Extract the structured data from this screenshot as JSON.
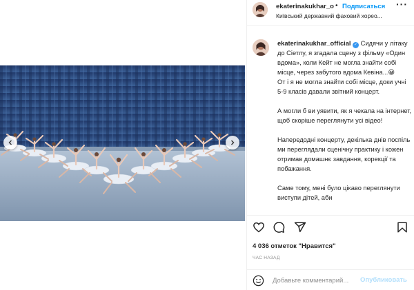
{
  "header": {
    "username": "ekaterinakukhar_o",
    "separator": "•",
    "follow_label": "Подписаться",
    "more_icon": "more-icon",
    "location": "Київський державний фаховий хорео..."
  },
  "caption": {
    "username": "ekaterinakukhar_official",
    "verified_icon": "verified-badge-icon",
    "paragraphs": [
      "Сидячи у літаку до Сіетлу, я згадала сцену з фільму «Один вдома», коли Кейт не могла знайти собі місце, через забутого вдома Кевіна...😀",
      "От і я не могла знайти собі місце, доки учні 5-9 класів давали звітний концерт.",
      "А могли б ви уявити, як я чекала на інтернет, щоб скоріше переглянути усі відео!",
      "Напередодні концерту, декілька днів поспіль ми переглядали сценічну практику і кожен отримав домашнє завдання, корекції та побажання.",
      "Саме тому, мені було цікаво переглянути виступи дітей, аби"
    ]
  },
  "media": {
    "prev_icon": "chevron-left-icon",
    "next_icon": "chevron-right-icon",
    "colors": {
      "curtain": "#2b4a7e",
      "floor": "#9fb3c9",
      "tutu": "#e8eef6"
    }
  },
  "actions": {
    "like_icon": "heart-icon",
    "comment_icon": "comment-icon",
    "share_icon": "share-icon",
    "save_icon": "bookmark-icon"
  },
  "likes": "4 036 отметок \"Нравится\"",
  "time_ago": "ЧАС НАЗАД",
  "add_comment": {
    "emoji_icon": "emoji-icon",
    "placeholder": "Добавьте комментарий...",
    "publish_label": "Опубликовать"
  }
}
